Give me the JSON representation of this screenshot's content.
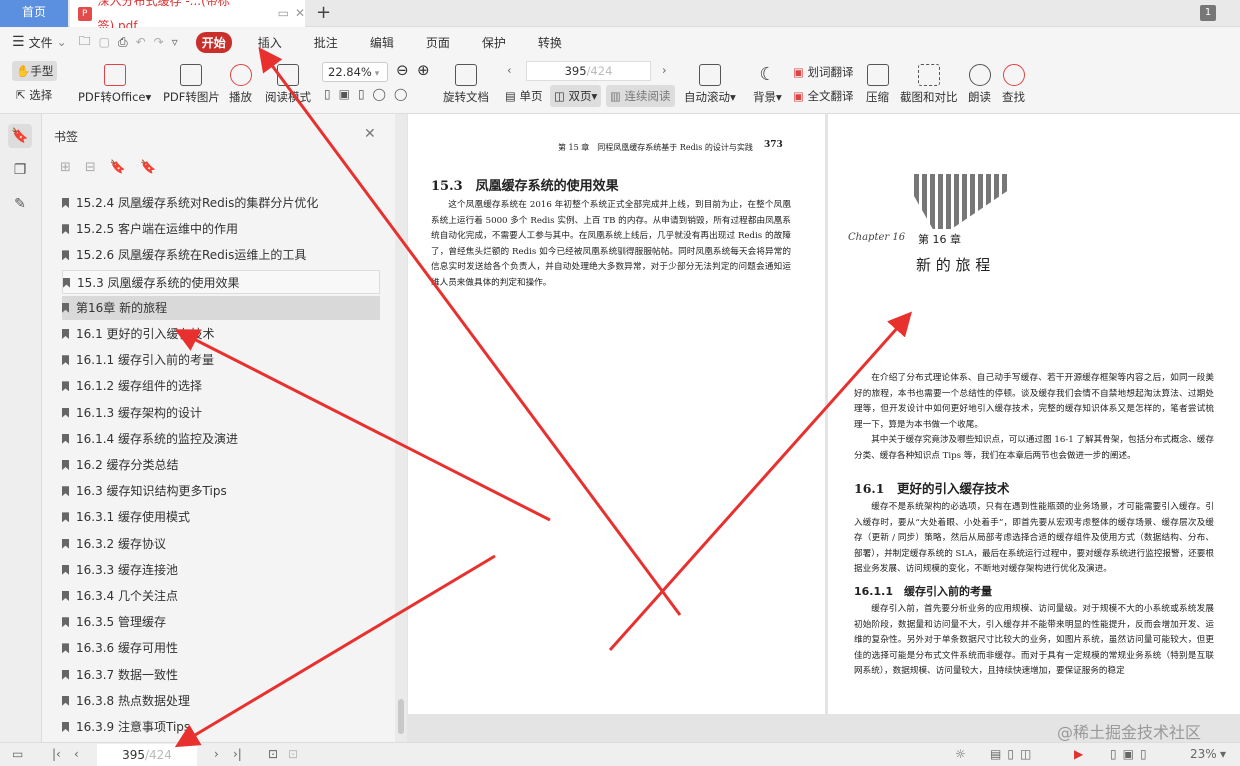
{
  "tabs": {
    "home": "首页",
    "document": "深入分布式缓存 -...(带标签).pdf",
    "new_tab": "+"
  },
  "menu": {
    "file": "文件",
    "items": [
      "开始",
      "插入",
      "批注",
      "编辑",
      "页面",
      "保护",
      "转换"
    ]
  },
  "toolbar": {
    "hand": "手型",
    "select": "选择",
    "pdf_to_office": "PDF转Office",
    "pdf_to_image": "PDF转图片",
    "play": "播放",
    "read_mode": "阅读模式",
    "zoom": "22.84%",
    "rotate": "旋转文档",
    "page_current": "395",
    "page_total": "/424",
    "single": "单页",
    "double": "双页",
    "continuous": "连续阅读",
    "auto_scroll": "自动滚动",
    "background": "背景",
    "word_translate": "划词翻译",
    "full_translate": "全文翻译",
    "compress": "压缩",
    "screenshot": "截图和对比",
    "read_aloud": "朗读",
    "find": "查找"
  },
  "panel": {
    "title": "书签",
    "items": [
      {
        "label": "15.2.4  凤凰缓存系统对Redis的集群分片优化"
      },
      {
        "label": "15.2.5  客户端在运维中的作用"
      },
      {
        "label": "15.2.6  凤凰缓存系统在Redis运维上的工具"
      },
      {
        "label": "15.3  凤凰缓存系统的使用效果"
      },
      {
        "label": "第16章  新的旅程"
      },
      {
        "label": "16.1  更好的引入缓存技术"
      },
      {
        "label": "16.1.1  缓存引入前的考量"
      },
      {
        "label": "16.1.2  缓存组件的选择"
      },
      {
        "label": "16.1.3  缓存架构的设计"
      },
      {
        "label": "16.1.4  缓存系统的监控及演进"
      },
      {
        "label": "16.2  缓存分类总结"
      },
      {
        "label": "16.3  缓存知识结构更多Tips"
      },
      {
        "label": "16.3.1  缓存使用模式"
      },
      {
        "label": "16.3.2  缓存协议"
      },
      {
        "label": "16.3.3  缓存连接池"
      },
      {
        "label": "16.3.4  几个关注点"
      },
      {
        "label": "16.3.5  管理缓存"
      },
      {
        "label": "16.3.6  缓存可用性"
      },
      {
        "label": "16.3.7  数据一致性"
      },
      {
        "label": "16.3.8  热点数据处理"
      },
      {
        "label": "16.3.9  注意事项Tips"
      }
    ]
  },
  "left_page": {
    "header": "第 15 章　同程凤凰缓存系统基于 Redis 的设计与实践",
    "page_no": "373",
    "heading": "15.3　凤凰缓存系统的使用效果",
    "para": "这个凤凰缓存系统在 2016 年初整个系统正式全部完成并上线，到目前为止，在整个凤凰系统上运行着 5000 多个 Redis 实例、上百 TB 的内存。从申请到销毁，所有过程都由凤凰系统自动化完成，不需要人工参与其中。在凤凰系统上线后，几乎就没有再出现过 Redis 的故障了，曾经焦头烂额的 Redis 如今已经被凤凰系统驯得服服帖帖。同时凤凰系统每天会将异常的信息实时发送给各个负责人，并自动处理绝大多数异常，对于少部分无法判定的问题会通知运维人员来做具体的判定和操作。"
  },
  "right_page": {
    "chapter_script": "Chapter 16",
    "chapter": "第 16 章",
    "title": "新 的 旅 程",
    "intro1": "在介绍了分布式理论体系、自己动手写缓存、若干开源缓存框架等内容之后，如同一段美好的旅程，本书也需要一个总结性的停顿。谈及缓存我们会情不自禁地想起淘汰算法、过期处理等，但开发设计中如何更好地引入缓存技术，完整的缓存知识体系又是怎样的，笔者尝试梳理一下，算是为本书做一个收尾。",
    "intro2": "其中关于缓存究竟涉及哪些知识点，可以通过图 16-1 了解其骨架，包括分布式概念、缓存分类、缓存各种知识点 Tips 等，我们在本章后两节也会做进一步的阐述。",
    "h1": "16.1　更好的引入缓存技术",
    "p1": "缓存不是系统架构的必选项，只有在遇到性能瓶颈的业务场景，才可能需要引入缓存。引入缓存时，要从“大处着眼、小处着手”，即首先要从宏观考虑整体的缓存场景、缓存层次及缓存（更新 / 同步）策略，然后从局部考虑选择合适的缓存组件及使用方式（数据结构、分布、部署），并制定缓存系统的 SLA，最后在系统运行过程中，要对缓存系统进行监控报警，还要根据业务发展、访问规模的变化，不断地对缓存架构进行优化及演进。",
    "h2": "16.1.1　缓存引入前的考量",
    "p2": "缓存引入前，首先要分析业务的应用规模、访问量级。对于规模不大的小系统或系统发展初始阶段，数据量和访问量不大，引入缓存并不能带来明显的性能提升，反而会增加开发、运维的复杂性。另外对于单条数据尺寸比较大的业务，如图片系统，虽然访问量可能较大，但更佳的选择可能是分布式文件系统而非缓存。而对于具有一定规模的常规业务系统（特别是互联网系统），数据规模、访问量较大，且持续快速增加，要保证服务的稳定"
  },
  "watermark": "@稀土掘金技术社区",
  "status": {
    "page_current": "395",
    "page_total": "/424",
    "zoom": "23%"
  },
  "colors": {
    "accent": "#c9302c",
    "arrow": "#e8312f",
    "home_tab": "#5b8fe0"
  }
}
